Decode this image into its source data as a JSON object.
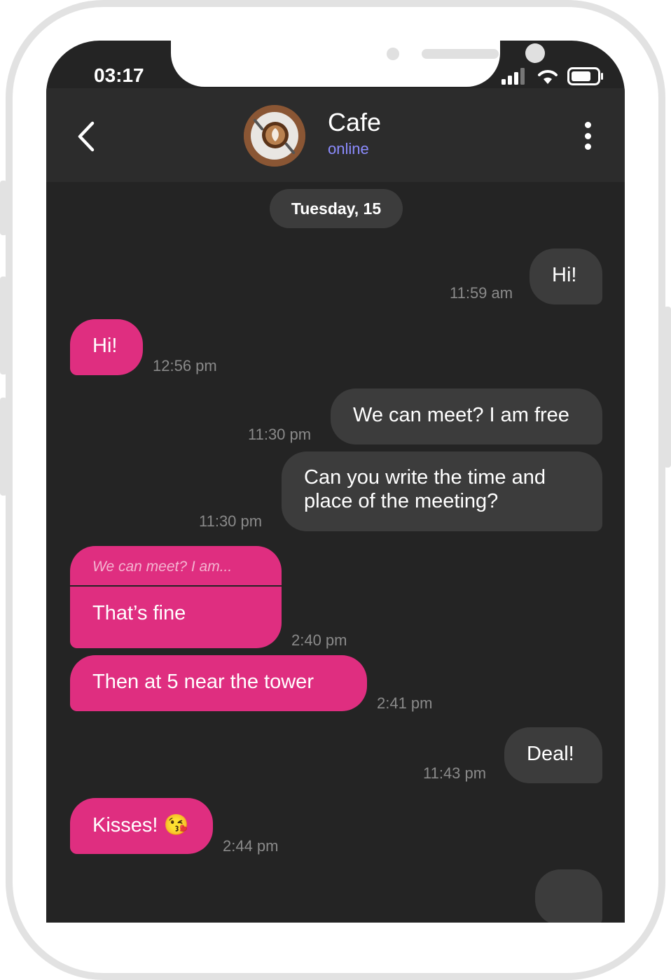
{
  "status_bar": {
    "time": "03:17"
  },
  "header": {
    "contact_name": "Cafe",
    "contact_status": "online"
  },
  "chat": {
    "date_label": "Tuesday, 15",
    "messages": [
      {
        "direction": "outgoing",
        "text": "Hi!",
        "time": "11:59 am"
      },
      {
        "direction": "incoming",
        "text": "Hi!",
        "time": "12:56 pm"
      },
      {
        "direction": "outgoing",
        "text": "We can meet? I am free",
        "time": "11:30 pm"
      },
      {
        "direction": "outgoing",
        "text": "Can you write the time and place of the meeting?",
        "time": "11:30 pm"
      },
      {
        "direction": "incoming",
        "quote": "We can meet? I am...",
        "text": "That’s fine",
        "time": "2:40 pm"
      },
      {
        "direction": "incoming",
        "text": "Then at 5 near the tower",
        "time": "2:41 pm"
      },
      {
        "direction": "outgoing",
        "text": "Deal!",
        "time": "11:43 pm"
      },
      {
        "direction": "incoming",
        "text": "Kisses! 😘",
        "time": "2:44 pm"
      }
    ]
  },
  "colors": {
    "incoming_bubble": "#df2e80",
    "outgoing_bubble": "#3c3c3c",
    "background": "#242424",
    "status_accent": "#8c8cff"
  }
}
